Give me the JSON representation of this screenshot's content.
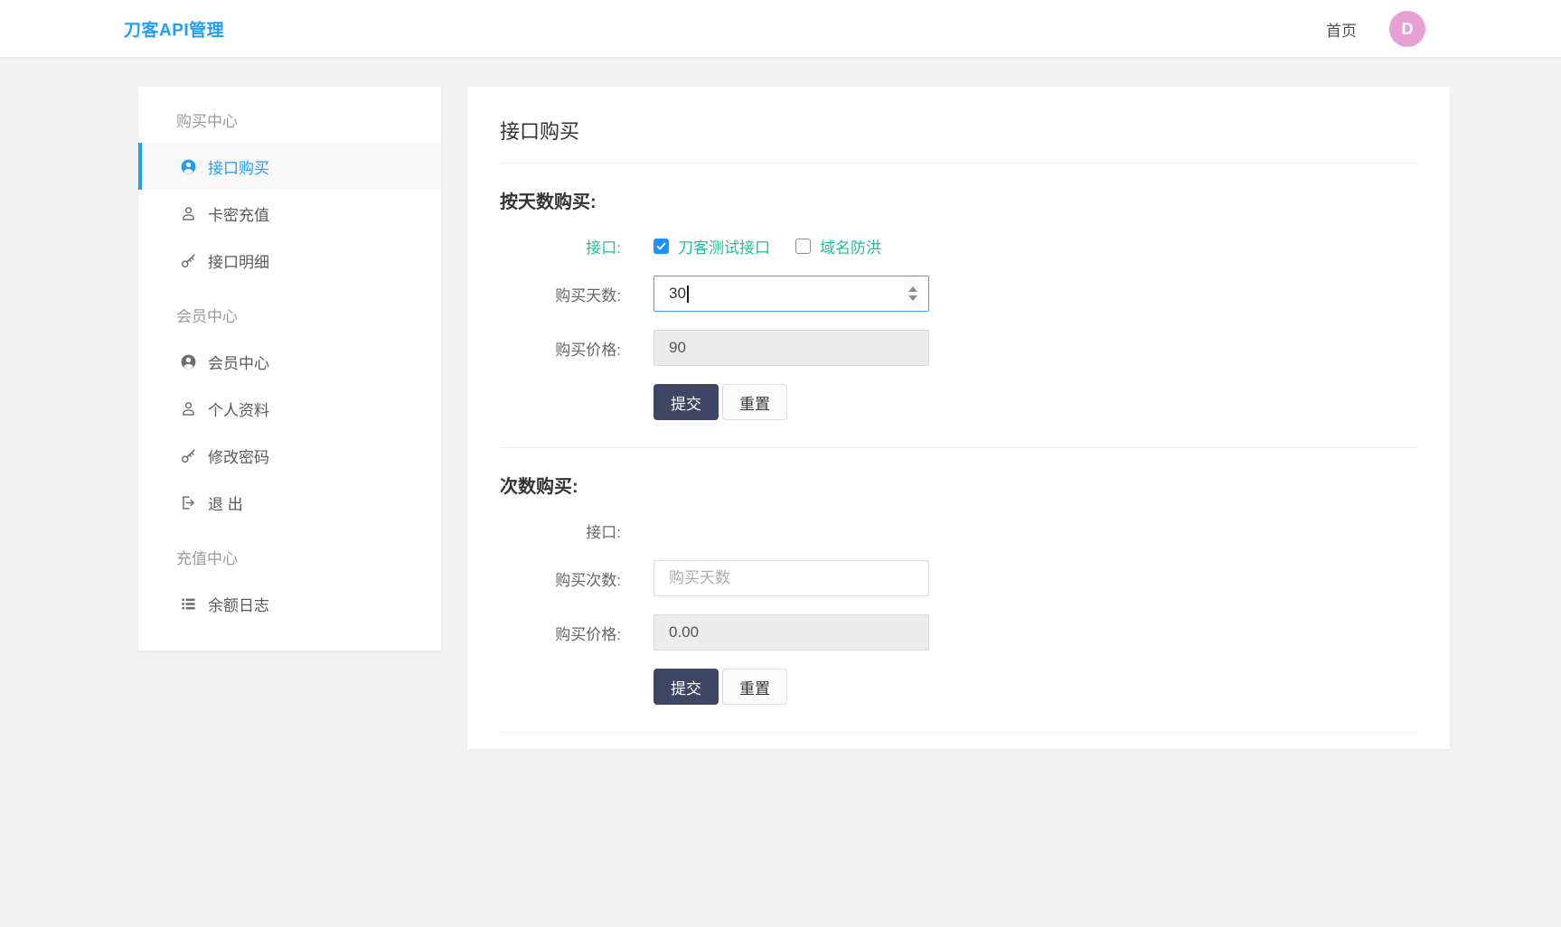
{
  "colors": {
    "accent_blue": "#1E9FFF",
    "link_green": "#1fbe9b",
    "submit_dark": "#3e4663",
    "avatar_pink": "#e7a0d5",
    "page_background": "#f2f2f2"
  },
  "header": {
    "brand": "刀客API管理",
    "home_link": "首页",
    "avatar_letter": "D"
  },
  "sidebar": {
    "sections": [
      {
        "title": "购买中心",
        "items": [
          {
            "label": "接口购买",
            "icon": "user-circle-icon",
            "active": true
          },
          {
            "label": "卡密充值",
            "icon": "user-outline-icon",
            "active": false
          },
          {
            "label": "接口明细",
            "icon": "key-icon",
            "active": false
          }
        ]
      },
      {
        "title": "会员中心",
        "items": [
          {
            "label": "会员中心",
            "icon": "user-circle-icon",
            "active": false
          },
          {
            "label": "个人资料",
            "icon": "user-outline-icon",
            "active": false
          },
          {
            "label": "修改密码",
            "icon": "key-icon",
            "active": false
          },
          {
            "label": "退 出",
            "icon": "sign-out-icon",
            "active": false
          }
        ]
      },
      {
        "title": "充值中心",
        "items": [
          {
            "label": "余额日志",
            "icon": "list-icon",
            "active": false
          }
        ]
      }
    ]
  },
  "main": {
    "card_title": "接口购买",
    "day_section": {
      "heading": "按天数购买:",
      "api_label": "接口:",
      "checkboxes": [
        {
          "label": "刀客测试接口",
          "checked": true
        },
        {
          "label": "域名防洪",
          "checked": false
        }
      ],
      "days_label": "购买天数:",
      "days_value": "30",
      "price_label": "购买价格:",
      "price_value": "90",
      "submit_label": "提交",
      "reset_label": "重置"
    },
    "count_section": {
      "heading": "次数购买:",
      "api_label": "接口:",
      "count_label": "购买次数:",
      "count_placeholder": "购买天数",
      "price_label": "购买价格:",
      "price_value": "0.00",
      "submit_label": "提交",
      "reset_label": "重置"
    }
  }
}
